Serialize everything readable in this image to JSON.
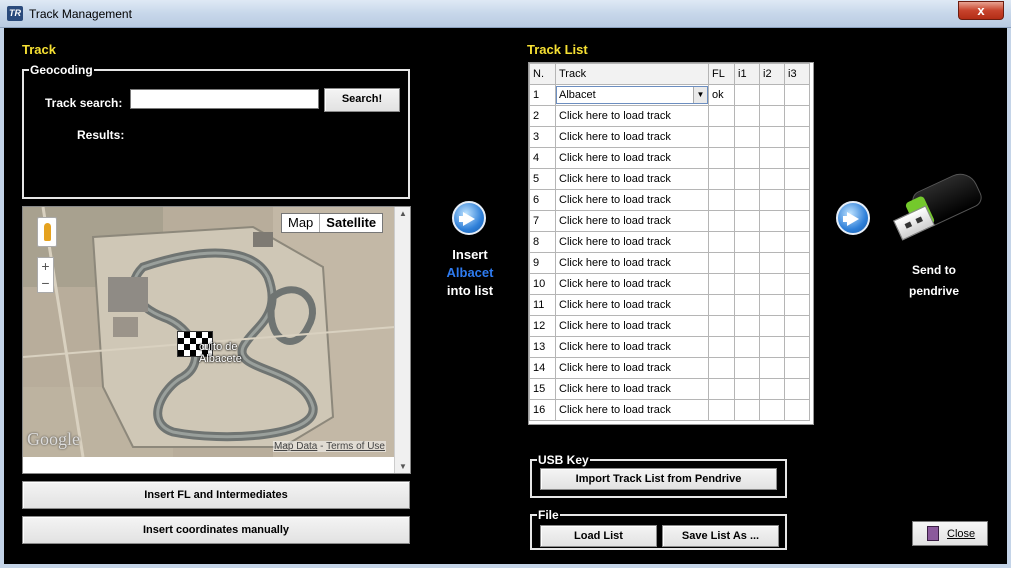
{
  "window": {
    "title": "Track Management",
    "app_icon": "TR",
    "close_glyph": "x"
  },
  "left": {
    "section_title": "Track",
    "geocoding": {
      "legend": "Geocoding",
      "search_label": "Track search:",
      "search_value": "",
      "search_button": "Search!",
      "results_label": "Results:"
    },
    "map": {
      "tab_map": "Map",
      "tab_satellite": "Satellite",
      "active_tab": "Satellite",
      "zoom_in": "+",
      "zoom_out": "−",
      "logo": "Google",
      "place_label_line1": "cuito de",
      "place_label_line2": "Albacete",
      "credit_data": "Map Data",
      "credit_sep": " - ",
      "credit_terms": "Terms of Use"
    },
    "insert_fl_button": "Insert FL and Intermediates",
    "insert_coords_button": "Insert coordinates manually"
  },
  "center": {
    "insert_line1": "Insert",
    "insert_track": "Albacet",
    "insert_line3": "into list",
    "accent_color": "#2e7bf0"
  },
  "tracklist": {
    "section_title": "Track List",
    "columns": [
      "N.",
      "Track",
      "FL",
      "i1",
      "i2",
      "i3"
    ],
    "rows": [
      {
        "n": "1",
        "track": "Albacet",
        "fl": "ok",
        "combo": true
      },
      {
        "n": "2",
        "track": "Click here to load track",
        "fl": ""
      },
      {
        "n": "3",
        "track": "Click here to load track",
        "fl": ""
      },
      {
        "n": "4",
        "track": "Click here to load track",
        "fl": ""
      },
      {
        "n": "5",
        "track": "Click here to load track",
        "fl": ""
      },
      {
        "n": "6",
        "track": "Click here to load track",
        "fl": ""
      },
      {
        "n": "7",
        "track": "Click here to load track",
        "fl": ""
      },
      {
        "n": "8",
        "track": "Click here to load track",
        "fl": ""
      },
      {
        "n": "9",
        "track": "Click here to load track",
        "fl": ""
      },
      {
        "n": "10",
        "track": "Click here to load track",
        "fl": ""
      },
      {
        "n": "11",
        "track": "Click here to load track",
        "fl": ""
      },
      {
        "n": "12",
        "track": "Click here to load track",
        "fl": ""
      },
      {
        "n": "13",
        "track": "Click here to load track",
        "fl": ""
      },
      {
        "n": "14",
        "track": "Click here to load track",
        "fl": ""
      },
      {
        "n": "15",
        "track": "Click here to load track",
        "fl": ""
      },
      {
        "n": "16",
        "track": "Click here to load track",
        "fl": ""
      }
    ]
  },
  "usb_key": {
    "legend": "USB Key",
    "import_button": "Import Track List from Pendrive"
  },
  "file": {
    "legend": "File",
    "load_button": "Load List",
    "save_button": "Save List As ..."
  },
  "right": {
    "send_line1": "Send to",
    "send_line2": "pendrive",
    "close_button": "Close"
  }
}
